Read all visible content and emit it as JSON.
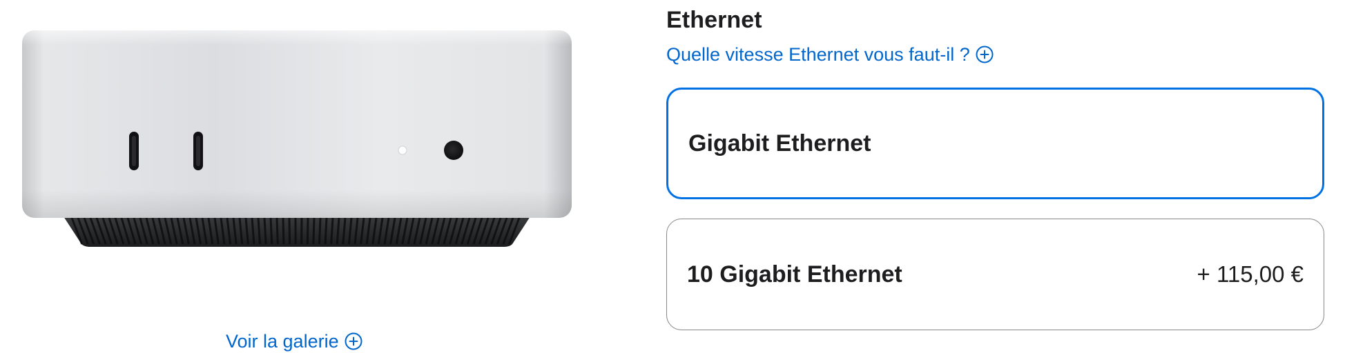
{
  "gallery": {
    "link_label": "Voir la galerie",
    "icon": "plus-circle-icon"
  },
  "ethernet": {
    "title": "Ethernet",
    "help_link": "Quelle vitesse Ethernet vous faut-il ?",
    "help_icon": "plus-circle-icon",
    "options": [
      {
        "name": "Gigabit Ethernet",
        "price": "",
        "selected": true
      },
      {
        "name": "10 Gigabit Ethernet",
        "price": "+ 115,00 €",
        "selected": false
      }
    ]
  },
  "colors": {
    "link": "#0066cc",
    "selected_border": "#0071e3",
    "card_border": "#86868b",
    "text": "#1d1d1f"
  }
}
